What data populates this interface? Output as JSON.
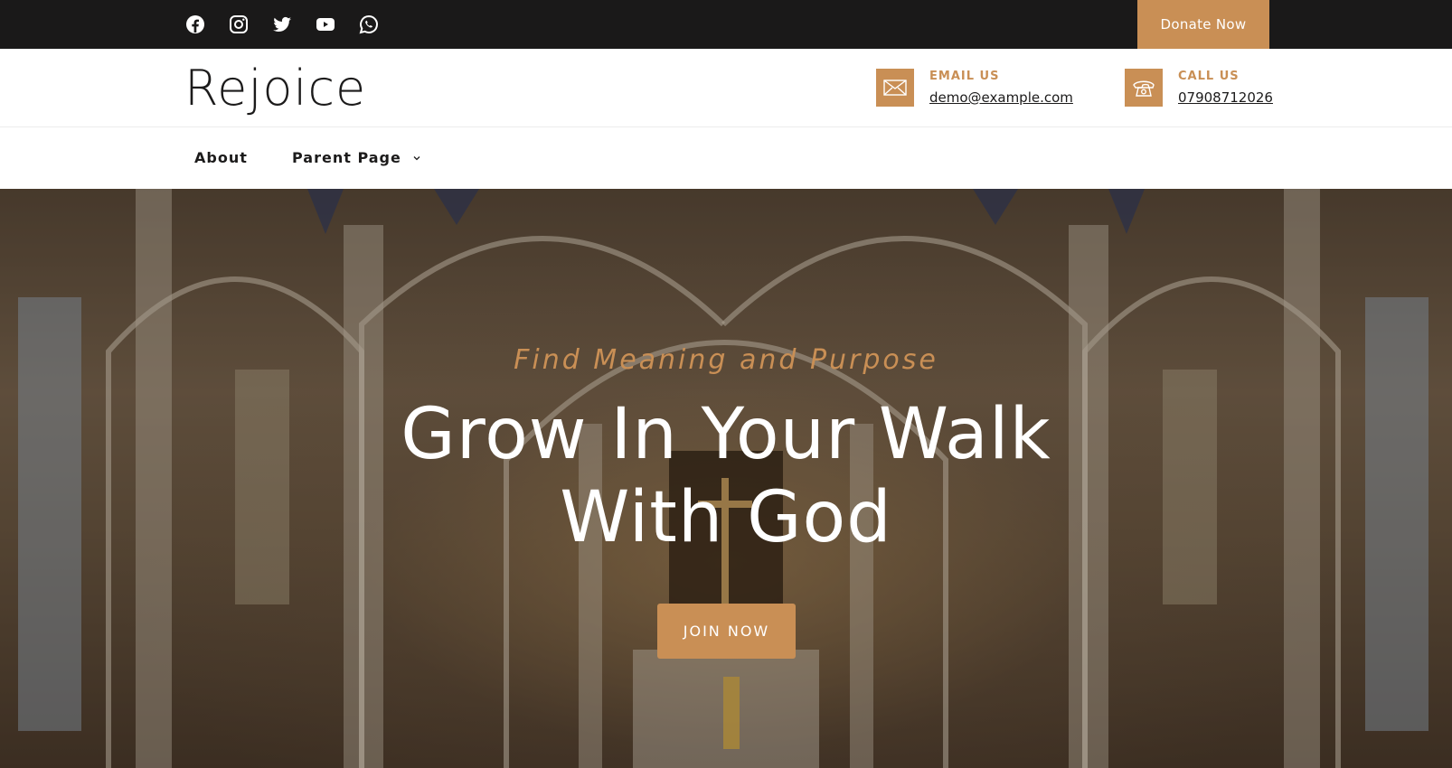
{
  "topbar": {
    "social_icons": [
      "facebook-icon",
      "instagram-icon",
      "twitter-icon",
      "youtube-icon",
      "whatsapp-icon"
    ],
    "donate_label": "Donate Now"
  },
  "header": {
    "logo": "Rejoice",
    "email": {
      "label": "EMAIL US",
      "value": "demo@example.com",
      "icon": "envelope-icon"
    },
    "call": {
      "label": "CALL US",
      "value": "07908712026",
      "icon": "phone-icon"
    }
  },
  "nav": {
    "items": [
      {
        "label": "About"
      },
      {
        "label": "Parent Page",
        "icon": "chevron-down-icon"
      }
    ]
  },
  "hero": {
    "subtitle": "Find Meaning and Purpose",
    "headline_line1": "Grow In Your Walk",
    "headline_line2": "With God",
    "cta_label": "JOIN NOW"
  },
  "colors": {
    "accent": "#c98f55",
    "topbar_bg": "#1a1919",
    "text_dark": "#1c1b1b",
    "white": "#ffffff"
  }
}
